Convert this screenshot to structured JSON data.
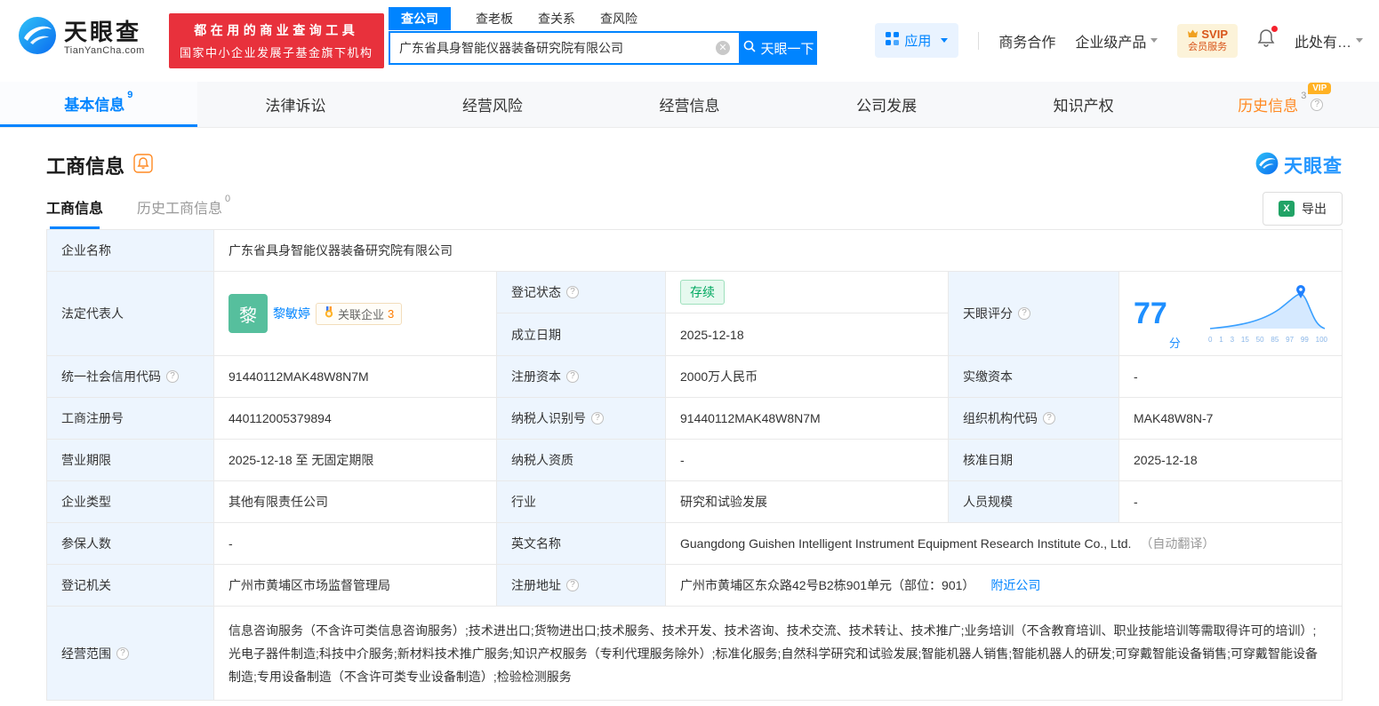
{
  "header": {
    "logo_brand": "天眼查",
    "logo_domain": "TianYanCha.com",
    "slogan_line1": "都在用的商业查询工具",
    "slogan_line2": "国家中小企业发展子基金旗下机构",
    "search_tabs": [
      "查公司",
      "查老板",
      "查关系",
      "查风险"
    ],
    "search_value": "广东省具身智能仪器装备研究院有限公司",
    "search_button": "天眼一下",
    "nav_apps": "应用",
    "nav_cooperation": "商务合作",
    "nav_enterprise": "企业级产品",
    "svip_top": "SVIP",
    "svip_bottom": "会员服务",
    "nav_more": "此处有…"
  },
  "tabs": {
    "basic": "基本信息",
    "basic_count": "9",
    "legal": "法律诉讼",
    "risk": "经营风险",
    "operation": "经营信息",
    "development": "公司发展",
    "ip": "知识产权",
    "history": "历史信息",
    "history_count": "3",
    "history_vip": "VIP"
  },
  "section": {
    "title": "工商信息",
    "brand": "天眼查",
    "subtab_current": "工商信息",
    "subtab_history": "历史工商信息",
    "subtab_history_count": "0",
    "export": "导出"
  },
  "biz": {
    "company_name": {
      "label": "企业名称",
      "value": "广东省具身智能仪器装备研究院有限公司"
    },
    "legal_rep": {
      "label": "法定代表人",
      "avatar_text": "黎",
      "name": "黎敏婷",
      "related_label": "关联企业",
      "related_count": "3"
    },
    "reg_status": {
      "label": "登记状态",
      "value": "存续"
    },
    "establish_date": {
      "label": "成立日期",
      "value": "2025-12-18"
    },
    "score": {
      "label": "天眼评分",
      "value": "77",
      "unit": "分",
      "ticks": [
        "0",
        "1",
        "3",
        "15",
        "50",
        "85",
        "97",
        "99",
        "100"
      ]
    },
    "credit_code": {
      "label": "统一社会信用代码",
      "value": "91440112MAK48W8N7M"
    },
    "reg_capital": {
      "label": "注册资本",
      "value": "2000万人民币"
    },
    "paid_capital": {
      "label": "实缴资本",
      "value": "-"
    },
    "reg_number": {
      "label": "工商注册号",
      "value": "440112005379894"
    },
    "taxpayer_id": {
      "label": "纳税人识别号",
      "value": "91440112MAK48W8N7M"
    },
    "org_code": {
      "label": "组织机构代码",
      "value": "MAK48W8N-7"
    },
    "business_term": {
      "label": "营业期限",
      "value": "2025-12-18 至 无固定期限"
    },
    "taxpayer_quality": {
      "label": "纳税人资质",
      "value": "-"
    },
    "approval_date": {
      "label": "核准日期",
      "value": "2025-12-18"
    },
    "company_type": {
      "label": "企业类型",
      "value": "其他有限责任公司"
    },
    "industry": {
      "label": "行业",
      "value": "研究和试验发展"
    },
    "staff_size": {
      "label": "人员规模",
      "value": "-"
    },
    "insured_count": {
      "label": "参保人数",
      "value": "-"
    },
    "english_name": {
      "label": "英文名称",
      "value": "Guangdong Guishen Intelligent Instrument Equipment Research Institute Co., Ltd.",
      "note": "（自动翻译）"
    },
    "reg_authority": {
      "label": "登记机关",
      "value": "广州市黄埔区市场监督管理局"
    },
    "reg_address": {
      "label": "注册地址",
      "value": "广州市黄埔区东众路42号B2栋901单元（部位：901）",
      "link": "附近公司"
    },
    "business_scope": {
      "label": "经营范围",
      "value": "信息咨询服务（不含许可类信息咨询服务）;技术进出口;货物进出口;技术服务、技术开发、技术咨询、技术交流、技术转让、技术推广;业务培训（不含教育培训、职业技能培训等需取得许可的培训）;光电子器件制造;科技中介服务;新材料技术推广服务;知识产权服务（专利代理服务除外）;标准化服务;自然科学研究和试验发展;智能机器人销售;智能机器人的研发;可穿戴智能设备销售;可穿戴智能设备制造;专用设备制造（不含许可类专业设备制造）;检验检测服务"
    }
  }
}
